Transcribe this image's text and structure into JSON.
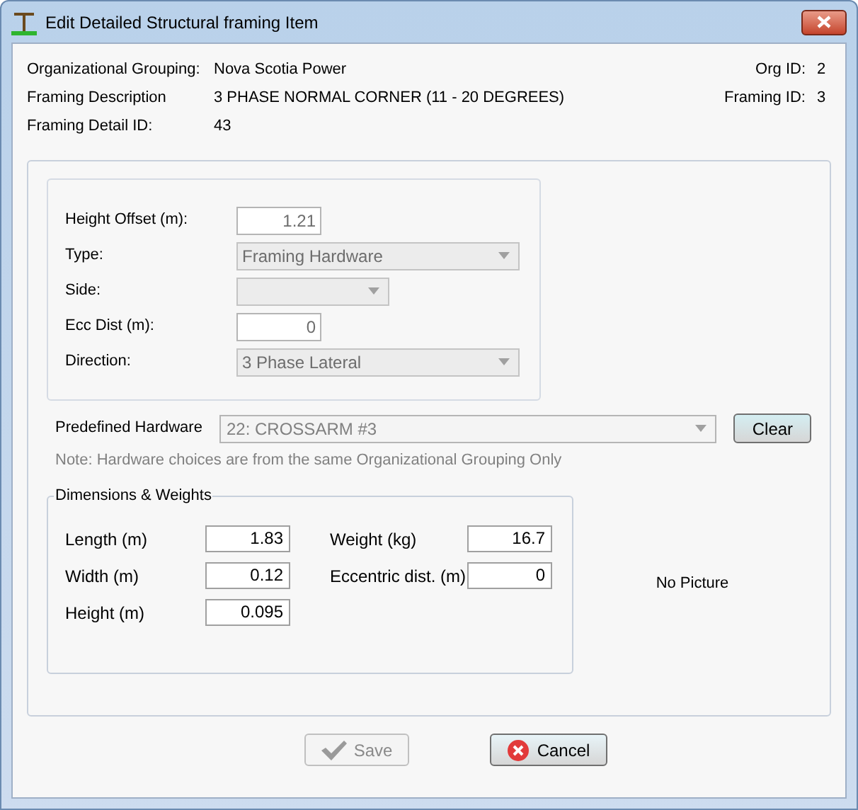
{
  "window": {
    "title": "Edit Detailed Structural framing Item"
  },
  "header": {
    "left": [
      {
        "label": "Organizational Grouping:",
        "value": "Nova Scotia Power"
      },
      {
        "label": "Framing Description",
        "value": "3 PHASE NORMAL CORNER (11 - 20 DEGREES)"
      },
      {
        "label": "Framing Detail ID:",
        "value": "43"
      }
    ],
    "right": [
      {
        "label": "Org ID:",
        "value": "2"
      },
      {
        "label": "Framing ID:",
        "value": "3"
      }
    ]
  },
  "placement": {
    "fields": [
      {
        "label": "Height Offset (m):",
        "kind": "text",
        "value": "1.21",
        "disabled": true
      },
      {
        "label": "Type:",
        "kind": "select",
        "value": "Framing Hardware",
        "disabled": true
      },
      {
        "label": "Side:",
        "kind": "select",
        "disabled": true
      },
      {
        "label": "Ecc Dist (m):",
        "kind": "text",
        "value": "0",
        "disabled": true
      },
      {
        "label": "Direction:",
        "kind": "select",
        "value": "3 Phase Lateral",
        "disabled": true
      }
    ]
  },
  "predefined_hardware": {
    "label": "Predefined Hardware",
    "value": "22: CROSSARM #3",
    "disabled": true,
    "clear_button": "Clear",
    "note": "Note: Hardware choices are from the same Organizational Grouping Only"
  },
  "dimensions": {
    "title": "Dimensions & Weights",
    "left": [
      {
        "label": "Length (m)",
        "value": "1.83"
      },
      {
        "label": "Width (m)",
        "value": "0.12"
      },
      {
        "label": "Height (m)",
        "value": "0.095"
      }
    ],
    "right": [
      {
        "label": "Weight (kg)",
        "value": "16.7"
      },
      {
        "label": "Eccentric dist. (m)",
        "value": "0"
      }
    ]
  },
  "picture_placeholder": "No Picture",
  "buttons": [
    {
      "label": "Save",
      "kind": "save",
      "disabled": true
    },
    {
      "label": "Cancel",
      "kind": "cancel",
      "disabled": false
    }
  ]
}
